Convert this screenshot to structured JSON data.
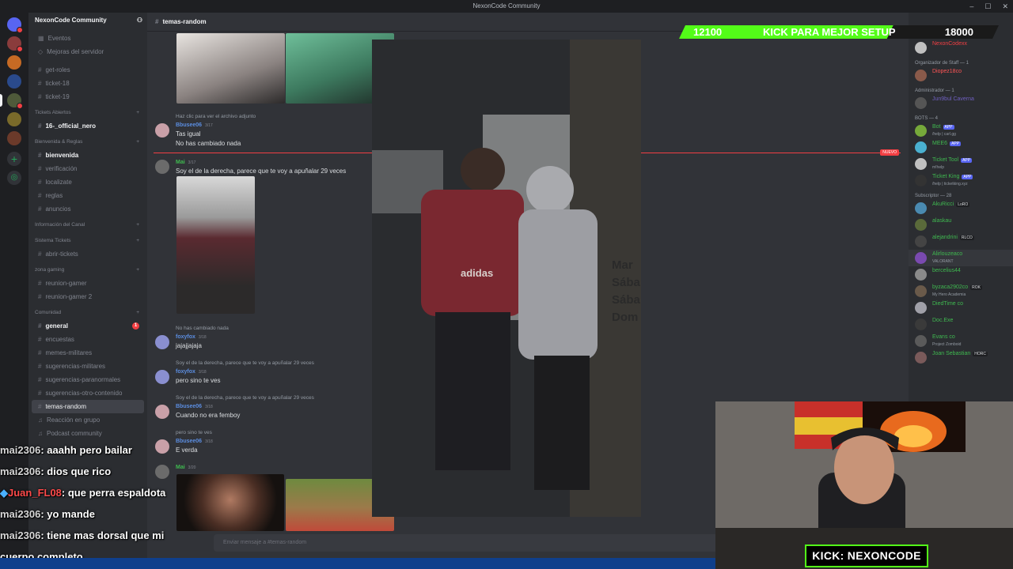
{
  "window": {
    "title": "NexonCode Community"
  },
  "server": {
    "name": "NexonCode Community"
  },
  "channels": {
    "top": [
      "Eventos",
      "Mejoras del servidor"
    ],
    "misc": [
      "get-roles",
      "ticket-18",
      "ticket-19"
    ],
    "cat_tickets_abiertos": "Tickets Abiertos",
    "ticket_open": "16-_official_nero",
    "cat_bienvenida": "Bienvenida & Reglas",
    "bienvenida": [
      "bienvenida",
      "verificación",
      "localizate",
      "reglas",
      "anuncios"
    ],
    "cat_info": "Información del Canal",
    "cat_sistema": "Sistema Tickets",
    "abrir_tickets": "abrir-tickets",
    "cat_gaming": "zona gaming",
    "gaming": [
      "reunion-gamer",
      "reunion-gamer 2"
    ],
    "cat_comunidad": "Comunidad",
    "comunidad": [
      "general",
      "encuestas",
      "memes-militares",
      "sugerencias-militares",
      "sugerencias-paranormales",
      "sugerencias-otro-contenido",
      "temas-random",
      "Reacción en grupo",
      "Podcast community"
    ]
  },
  "chat": {
    "channel": "temas-random",
    "new_label": "NUEVO",
    "input_placeholder": "Enviar mensaje a #temas-random",
    "messages": [
      {
        "reply": "Haz clic para ver el archivo adjunto",
        "author": "Bbusee06",
        "time": "3/17",
        "text": "Tas igual",
        "text2": "No has cambiado nada"
      },
      {
        "author": "Mai",
        "time": "3/17",
        "text": "Soy el de la derecha, parece que te voy a apuñalar 29 veces"
      },
      {
        "reply": "No has cambiado nada",
        "author": "foxyfox",
        "time": "3/18",
        "text": "jajajjajaja"
      },
      {
        "reply": "Soy el de la derecha, parece que te voy a apuñalar 29 veces",
        "author": "foxyfox",
        "time": "3/18",
        "text": "pero sino te ves"
      },
      {
        "reply": "Soy el de la derecha, parece que te voy a apuñalar 29 veces",
        "author": "Bbusee06",
        "time": "3/18",
        "text": "Cuando no era femboy"
      },
      {
        "reply": "pero sino te ves",
        "author": "Bbusee06",
        "time": "3/18",
        "text": "E verda"
      },
      {
        "author": "Mai",
        "time": "3/20",
        "text": ""
      }
    ]
  },
  "members": {
    "cat_owner": "Owner — 1",
    "owner": "NexonCodexx",
    "cat_staff": "Organizador de Staff — 1",
    "staff": "Diopez18co",
    "cat_admin": "Administrador — 1",
    "admin": "Jun9bul Caverna",
    "cat_bots": "BOTS — 4",
    "bots": [
      {
        "name": "Bot",
        "sub": "/help | carl.gg"
      },
      {
        "name": "MEE6",
        "sub": ""
      },
      {
        "name": "Ticket Tool",
        "sub": "m!help"
      },
      {
        "name": "Ticket King",
        "sub": "/help | ticketking.xyz"
      }
    ],
    "app_tag": "APP",
    "cat_subs": "Subscriptor — 28",
    "subs": [
      {
        "name": "AkuRicci",
        "tag": "LoRO",
        "sub": ""
      },
      {
        "name": "alaskau",
        "tag": "",
        "sub": ""
      },
      {
        "name": "alejandrini",
        "tag": "RLCO",
        "sub": ""
      },
      {
        "name": "Alirlouzeaco",
        "tag": "",
        "sub": "VALORANT"
      },
      {
        "name": "bercelius44",
        "tag": "",
        "sub": ""
      },
      {
        "name": "byzaca2902co",
        "tag": "ROK",
        "sub": "My Hero Academia"
      },
      {
        "name": "DiedTime co",
        "tag": "",
        "sub": ""
      },
      {
        "name": "Doc.Exe",
        "tag": "",
        "sub": ""
      },
      {
        "name": "Evans co",
        "tag": "",
        "sub": "Project Zomboid"
      },
      {
        "name": "Joan Sebastian",
        "tag": "HORC",
        "sub": ""
      }
    ]
  },
  "stream": {
    "goal_current": "12100",
    "goal_label": "KICK PARA MEJOR SETUP",
    "goal_target": "18000",
    "goal_fraction": 0.67,
    "kick_badge": "KICK: NEXONCODE",
    "chat": [
      {
        "user": "mai2306",
        "text": ": aaahh pero bailar"
      },
      {
        "user": "mai2306",
        "text": ": dios que rico"
      },
      {
        "user": "Juan_FL08",
        "text": ": que perra espaldota"
      },
      {
        "user": "mai2306",
        "text": ": yo mande"
      },
      {
        "user": "mai2306",
        "text": ": tiene mas dorsal que mi"
      },
      {
        "user": "",
        "text": "cuerpo completo"
      }
    ],
    "overlay_photo_text": [
      "adidas",
      "Mar",
      "Sába",
      "Sába",
      "Dom"
    ]
  },
  "colors": {
    "accent": "#5865f2",
    "kick_green": "#53fc18",
    "mention_red": "#f23f43"
  }
}
